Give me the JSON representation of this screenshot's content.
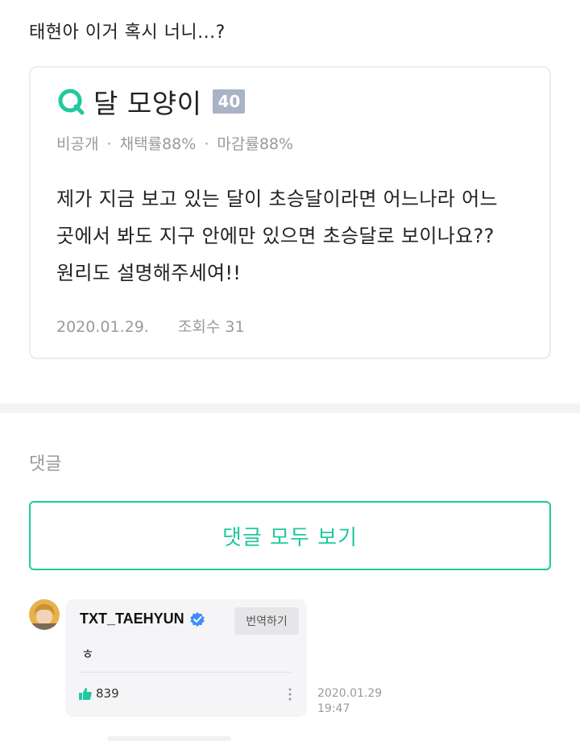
{
  "post": {
    "text": "태현아 이거 혹시 너니...?"
  },
  "qna": {
    "title": "달 모양이",
    "badge": "40",
    "meta": [
      "비공개",
      "채택률88%",
      "마감률88%"
    ],
    "meta_separator": "·",
    "body_lines": [
      "제가 지금 보고 있는 달이 초승달이라면 어느나라 어느",
      "곳에서 봐도 지구 안에만 있으면 초승달로 보이나요??",
      "원리도 설명해주세여!!"
    ],
    "date": "2020.01.29.",
    "views": "조회수 31",
    "accent_color": "#22c89e"
  },
  "comments": {
    "heading": "댓글",
    "view_all_label": "댓글 모두 보기",
    "items": [
      {
        "author": "TXT_TAEHYUN",
        "verified": true,
        "translate_label": "번역하기",
        "text": "ㅎ",
        "likes": "839",
        "date": "2020.01.29",
        "time": "19:47"
      }
    ]
  },
  "icons": {
    "search": "q-logo-icon",
    "verified": "verified-check-icon",
    "like": "thumbs-up-icon",
    "more": "more-vertical-icon"
  }
}
